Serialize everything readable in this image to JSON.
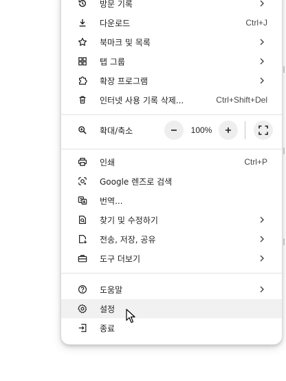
{
  "menu": {
    "items": [
      {
        "label": "방문 기록",
        "icon": "history-icon",
        "shortcut": "",
        "submenu": true
      },
      {
        "label": "다운로드",
        "icon": "download-icon",
        "shortcut": "Ctrl+J",
        "submenu": false
      },
      {
        "label": "북마크 및 목록",
        "icon": "star-icon",
        "shortcut": "",
        "submenu": true
      },
      {
        "label": "탭 그룹",
        "icon": "tab-groups-icon",
        "shortcut": "",
        "submenu": true
      },
      {
        "label": "확장 프로그램",
        "icon": "extension-icon",
        "shortcut": "",
        "submenu": true
      },
      {
        "label": "인터넷 사용 기록 삭제...",
        "icon": "trash-icon",
        "shortcut": "Ctrl+Shift+Del",
        "submenu": false
      }
    ],
    "zoom": {
      "label": "확대/축소",
      "minus": "−",
      "level": "100%",
      "plus": "+"
    },
    "items2": [
      {
        "label": "인쇄",
        "icon": "print-icon",
        "shortcut": "Ctrl+P",
        "submenu": false
      },
      {
        "label": "Google 렌즈로 검색",
        "icon": "lens-icon",
        "shortcut": "",
        "submenu": false
      },
      {
        "label": "번역...",
        "icon": "translate-icon",
        "shortcut": "",
        "submenu": false
      },
      {
        "label": "찾기 및 수정하기",
        "icon": "find-icon",
        "shortcut": "",
        "submenu": true
      },
      {
        "label": "전송, 저장, 공유",
        "icon": "cast-save-share-icon",
        "shortcut": "",
        "submenu": true
      },
      {
        "label": "도구 더보기",
        "icon": "toolbox-icon",
        "shortcut": "",
        "submenu": true
      }
    ],
    "items3": [
      {
        "label": "도움말",
        "icon": "help-icon",
        "shortcut": "",
        "submenu": true
      },
      {
        "label": "설정",
        "icon": "settings-icon",
        "shortcut": "",
        "submenu": false,
        "hovered": true
      },
      {
        "label": "종료",
        "icon": "exit-icon",
        "shortcut": "",
        "submenu": false
      }
    ]
  },
  "colors": {
    "text": "#1f1f1f",
    "shortcut": "#474747",
    "hover": "#f1f1f1",
    "separator": "#dfe3e7"
  }
}
